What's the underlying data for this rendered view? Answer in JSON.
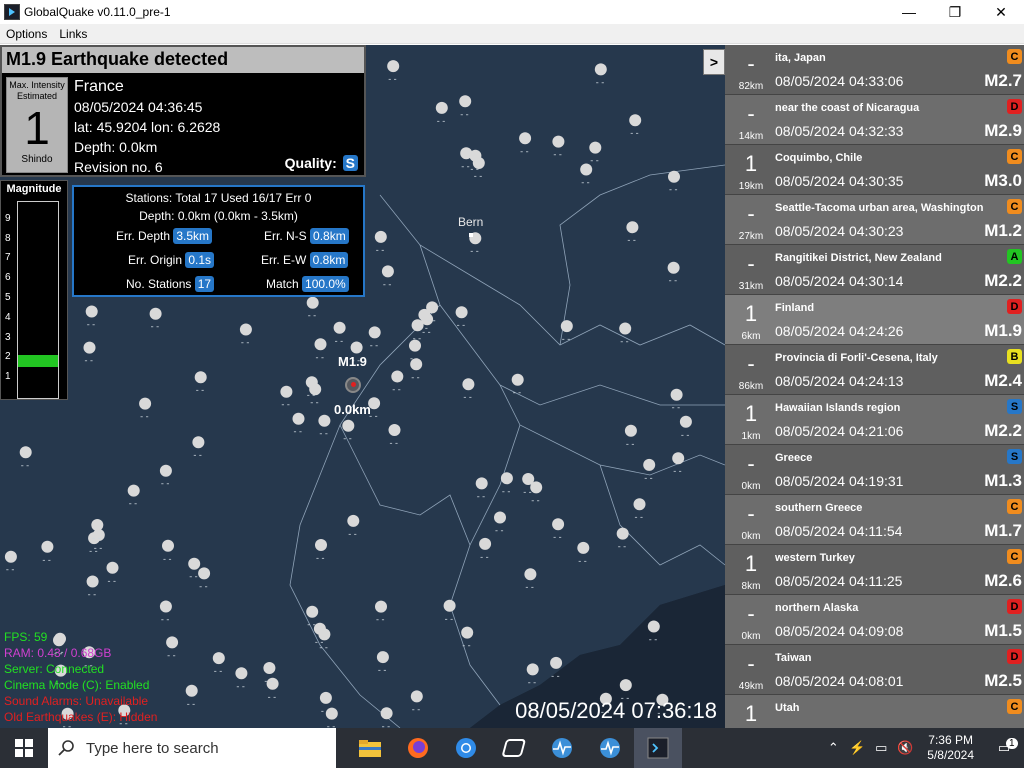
{
  "window": {
    "title": "GlobalQuake v0.11.0_pre-1",
    "minimize": "—",
    "maximize": "❐",
    "close": "✕"
  },
  "menu": {
    "items": [
      "Options",
      "Links"
    ]
  },
  "quake": {
    "header": "M1.9 Earthquake detected",
    "intensity_label": "Max. Intensity Estimated",
    "intensity_value": "1",
    "intensity_scale": "Shindo",
    "region": "France",
    "time": "08/05/2024 04:36:45",
    "coords": "lat: 45.9204 lon: 6.2628",
    "depth": "Depth: 0.0km",
    "revision": "Revision no. 6",
    "quality_label": "Quality:",
    "quality_value": "S"
  },
  "magnitude_bar": {
    "title": "Magnitude",
    "ticks": [
      "9",
      "8",
      "7",
      "6",
      "5",
      "4",
      "3",
      "2",
      "1"
    ],
    "level": 1.9
  },
  "stats": {
    "stations_line": "Stations: Total 17 Used 16/17 Err 0",
    "depth_line": "Depth: 0.0km (0.0km - 3.5km)",
    "err_depth_label": "Err. Depth",
    "err_depth_value": "3.5km",
    "err_ns_label": "Err. N-S",
    "err_ns_value": "0.8km",
    "err_origin_label": "Err. Origin",
    "err_origin_value": "0.1s",
    "err_ew_label": "Err. E-W",
    "err_ew_value": "0.8km",
    "no_stations_label": "No. Stations",
    "no_stations_value": "17",
    "match_label": "Match",
    "match_value": "100.0%"
  },
  "map": {
    "toggle_label": ">",
    "city_label": "Bern",
    "epicenter_mag": "M1.9",
    "epicenter_depth": "0.0km",
    "clock": "08/05/2024 07:36:18"
  },
  "overlay": {
    "fps": "FPS: 59",
    "ram": "RAM: 0.43 / 0.68GB",
    "server": "Server: Connected",
    "cinema": "Cinema Mode (C): Enabled",
    "sound": "Sound Alarms: Unavailable",
    "old": "Old Earthquakes (E): Hidden"
  },
  "quakes": [
    {
      "region": "ita, Japan",
      "time": "08/05/2024 04:33:06",
      "mag": "M2.7",
      "depth": "82km",
      "intensity": "-",
      "badge": "C"
    },
    {
      "region": "near the coast of Nicaragua",
      "time": "08/05/2024 04:32:33",
      "mag": "M2.9",
      "depth": "14km",
      "intensity": "-",
      "badge": "D"
    },
    {
      "region": "Coquimbo, Chile",
      "time": "08/05/2024 04:30:35",
      "mag": "M3.0",
      "depth": "19km",
      "intensity": "1",
      "badge": "C"
    },
    {
      "region": "Seattle-Tacoma urban area, Washington",
      "time": "08/05/2024 04:30:23",
      "mag": "M1.2",
      "depth": "27km",
      "intensity": "-",
      "badge": "C"
    },
    {
      "region": "Rangitikei District, New Zealand",
      "time": "08/05/2024 04:30:14",
      "mag": "M2.2",
      "depth": "31km",
      "intensity": "-",
      "badge": "A"
    },
    {
      "region": "Finland",
      "time": "08/05/2024 04:24:26",
      "mag": "M1.9",
      "depth": "6km",
      "intensity": "1",
      "badge": "D"
    },
    {
      "region": "Provincia di Forli'-Cesena, Italy",
      "time": "08/05/2024 04:24:13",
      "mag": "M2.4",
      "depth": "86km",
      "intensity": "-",
      "badge": "B"
    },
    {
      "region": "Hawaiian Islands region",
      "time": "08/05/2024 04:21:06",
      "mag": "M2.2",
      "depth": "1km",
      "intensity": "1",
      "badge": "S"
    },
    {
      "region": "Greece",
      "time": "08/05/2024 04:19:31",
      "mag": "M1.3",
      "depth": "0km",
      "intensity": "-",
      "badge": "S"
    },
    {
      "region": "southern Greece",
      "time": "08/05/2024 04:11:54",
      "mag": "M1.7",
      "depth": "0km",
      "intensity": "-",
      "badge": "C"
    },
    {
      "region": "western Turkey",
      "time": "08/05/2024 04:11:25",
      "mag": "M2.6",
      "depth": "8km",
      "intensity": "1",
      "badge": "C"
    },
    {
      "region": "northern Alaska",
      "time": "08/05/2024 04:09:08",
      "mag": "M1.5",
      "depth": "0km",
      "intensity": "-",
      "badge": "D"
    },
    {
      "region": "Taiwan",
      "time": "08/05/2024 04:08:01",
      "mag": "M2.5",
      "depth": "49km",
      "intensity": "-",
      "badge": "D"
    },
    {
      "region": "Utah",
      "time": "",
      "mag": "",
      "depth": "",
      "intensity": "1",
      "badge": "C"
    }
  ],
  "badge_colors": {
    "A": "#22c522",
    "B": "#e8e020",
    "C": "#f08c1e",
    "D": "#e02020",
    "S": "#2677c8"
  },
  "overlay_colors": {
    "fps": "#22e022",
    "ram": "#d040d0",
    "server": "#22e022",
    "cinema": "#22e022",
    "sound": "#e02020",
    "old": "#e02020"
  },
  "taskbar": {
    "search_placeholder": "Type here to search",
    "apps": [
      "file-explorer-icon",
      "firefox-icon",
      "chrome-icon",
      "app-icon",
      "globalquake-icon",
      "globalquake-icon-2",
      "terminal-icon"
    ],
    "time": "7:36 PM",
    "date": "5/8/2024",
    "notifications": "1"
  }
}
